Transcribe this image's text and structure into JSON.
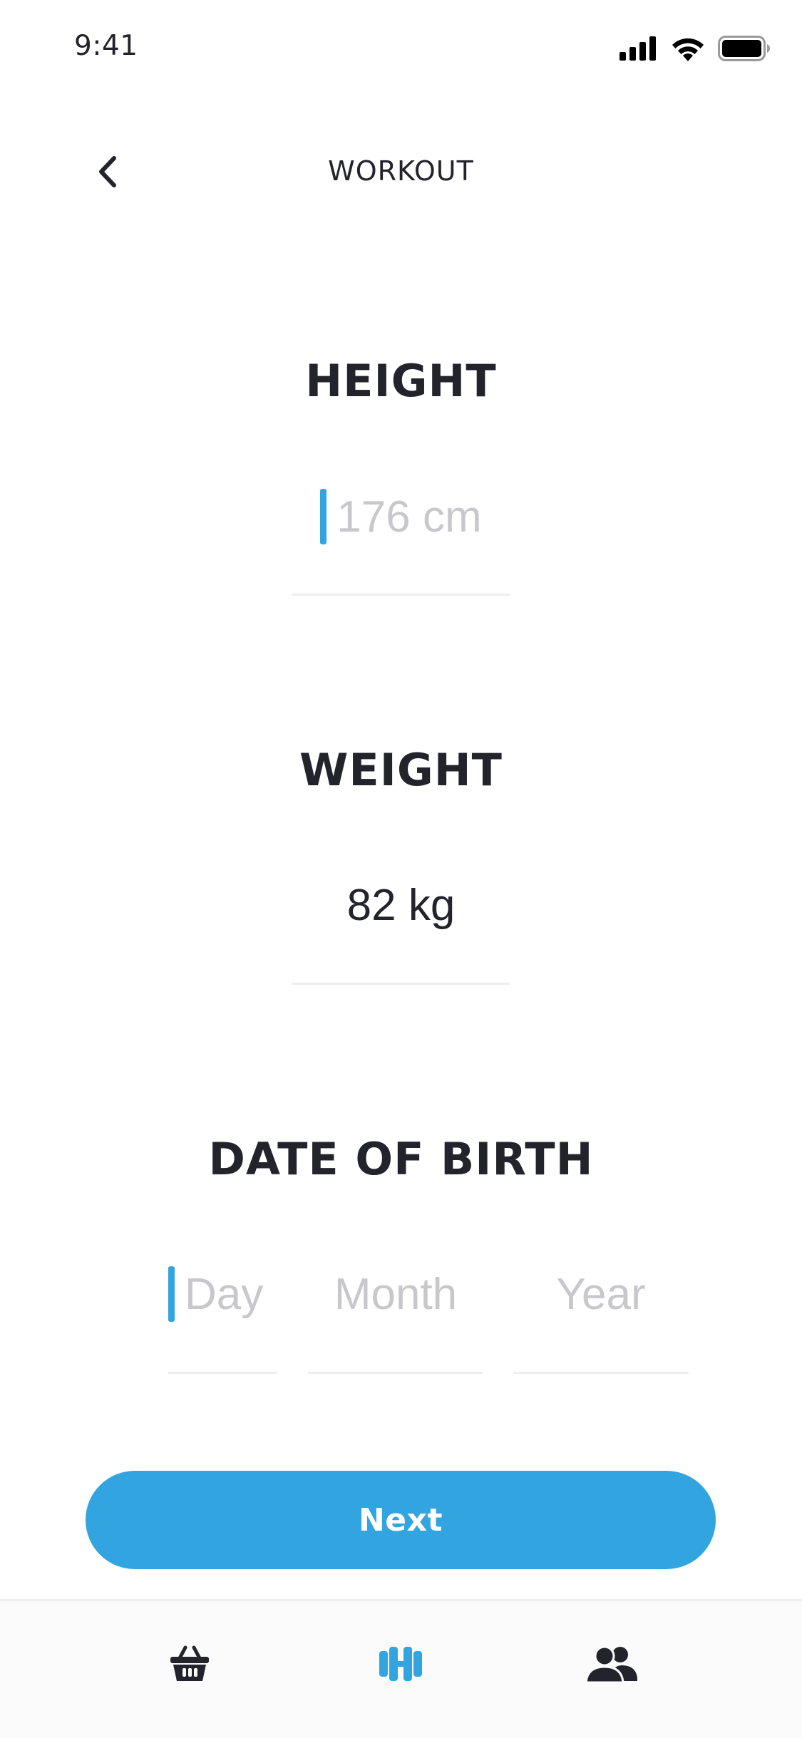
{
  "status_bar": {
    "time": "9:41",
    "icons": [
      "signal-icon",
      "wifi-icon",
      "battery-icon"
    ]
  },
  "header": {
    "title": "WORKOUT",
    "back_icon": "chevron-left-icon"
  },
  "form": {
    "height": {
      "label": "HEIGHT",
      "placeholder": "176 cm",
      "value": ""
    },
    "weight": {
      "label": "WEIGHT",
      "value": "82 kg"
    },
    "date_of_birth": {
      "label": "DATE OF BIRTH",
      "day_placeholder": "Day",
      "month_placeholder": "Month",
      "year_placeholder": "Year"
    }
  },
  "next_button": {
    "label": "Next"
  },
  "tab_bar": {
    "tabs": [
      {
        "icon": "basket-icon",
        "active": false
      },
      {
        "icon": "dumbbell-icon",
        "active": true
      },
      {
        "icon": "users-icon",
        "active": false
      }
    ]
  },
  "colors": {
    "accent": "#32A5E0",
    "text": "#23232B",
    "placeholder": "#C8C8CC",
    "divider": "#EEEEF0"
  }
}
